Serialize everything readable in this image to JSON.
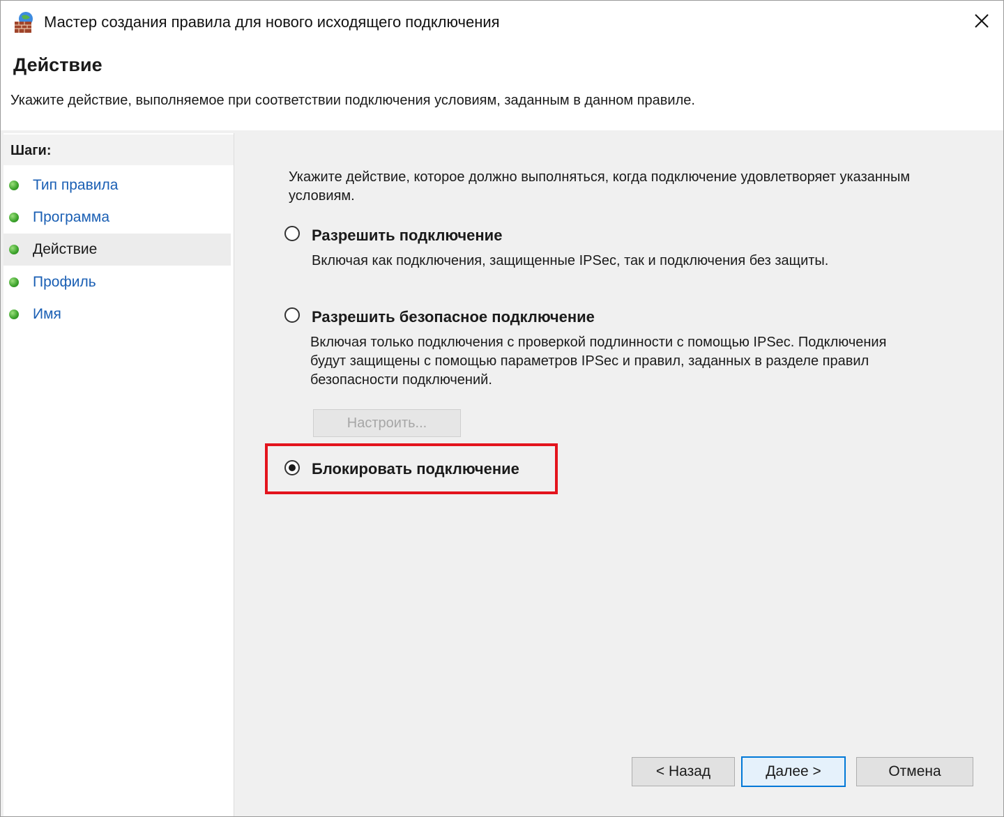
{
  "window": {
    "title": "Мастер создания правила для нового исходящего подключения",
    "icon": "firewall-icon",
    "close_icon": "close-icon"
  },
  "header": {
    "title": "Действие",
    "subtitle": "Укажите действие, выполняемое при соответствии подключения условиям, заданным в данном правиле."
  },
  "sidebar": {
    "title": "Шаги:",
    "items": [
      {
        "label": "Тип правила",
        "current": false
      },
      {
        "label": "Программа",
        "current": false
      },
      {
        "label": "Действие",
        "current": true
      },
      {
        "label": "Профиль",
        "current": false
      },
      {
        "label": "Имя",
        "current": false
      }
    ]
  },
  "main": {
    "instruction": "Укажите действие, которое должно выполняться, когда подключение удовлетворяет указанным условиям.",
    "options": [
      {
        "label": "Разрешить подключение",
        "description": "Включая как подключения, защищенные IPSec, так и подключения без защиты.",
        "selected": false
      },
      {
        "label": "Разрешить безопасное подключение",
        "description": "Включая только подключения с проверкой подлинности с помощью IPSec. Подключения будут защищены с помощью параметров IPSec и правил, заданных в разделе правил безопасности подключений.",
        "selected": false
      },
      {
        "label": "Блокировать подключение",
        "description": "",
        "selected": true
      }
    ],
    "configure_button": "Настроить...",
    "highlight_color": "#e3141d"
  },
  "footer": {
    "back": "< Назад",
    "next": "Далее >",
    "cancel": "Отмена"
  },
  "colors": {
    "link": "#1a5fb4",
    "step_dot": "#3aa12a",
    "content_bg": "#f0f0f0",
    "default_button_border": "#0078d7"
  }
}
